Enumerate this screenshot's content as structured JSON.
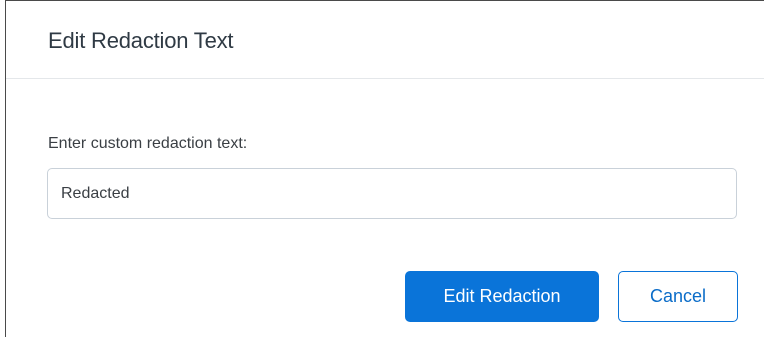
{
  "dialog": {
    "title": "Edit Redaction Text",
    "field_label": "Enter custom redaction text:",
    "input_value": "Redacted",
    "primary_button_label": "Edit Redaction",
    "secondary_button_label": "Cancel"
  },
  "colors": {
    "primary": "#0a74d9",
    "title_text": "#2f3a44",
    "body_text": "#3a3f44",
    "input_border": "#c9d1d9",
    "divider": "#e4e7ea"
  }
}
